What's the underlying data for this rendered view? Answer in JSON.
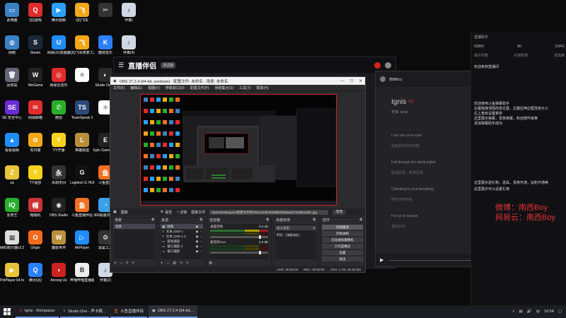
{
  "desktop_icons": [
    {
      "label": "此电脑",
      "color": "#3b82c4",
      "g": "▭"
    },
    {
      "label": "QQ游戏",
      "color": "#e02c2c",
      "g": "Q"
    },
    {
      "label": "腾讯视频",
      "color": "#2aa0ff",
      "g": "▶"
    },
    {
      "label": "QQ飞车",
      "color": "#f2a818",
      "g": "飞"
    },
    {
      "label": "",
      "color": "#333",
      "g": "✂"
    },
    {
      "label": "伴奏(",
      "color": "#cfd8e3",
      "g": "♪"
    },
    {
      "label": "网络",
      "color": "#3b82c4",
      "g": "◍"
    },
    {
      "label": "Steam",
      "color": "#1b2838",
      "g": "S"
    },
    {
      "label": "网易UU加速器",
      "color": "#1f8cff",
      "g": "U"
    },
    {
      "label": "QQ飞车修复工具",
      "color": "#f2a818",
      "g": "飞"
    },
    {
      "label": "酷狗音乐",
      "color": "#2a7fff",
      "g": "K"
    },
    {
      "label": "伴奏(4)",
      "color": "#cfd8e3",
      "g": "♪"
    },
    {
      "label": "回收站",
      "color": "#667",
      "g": "🗑"
    },
    {
      "label": "WeGame",
      "color": "#222",
      "g": "W"
    },
    {
      "label": "网易云音乐",
      "color": "#e02c2c",
      "g": "◎"
    },
    {
      "label": "",
      "color": "#fff",
      "g": "⚛"
    },
    {
      "label": "Studio One 4",
      "color": "#2a2a2a",
      "g": "◐"
    },
    {
      "label": "伴奏(1)",
      "color": "#cfd8e3",
      "g": "♪"
    },
    {
      "label": "SE 安全中心",
      "color": "#6b2bd6",
      "g": "SE"
    },
    {
      "label": "网易邮箱",
      "color": "#e02c2c",
      "g": "✉"
    },
    {
      "label": "微信",
      "color": "#2aae2a",
      "g": "✆"
    },
    {
      "label": "TeamSpeak 3",
      "color": "#2c4a7a",
      "g": "TS"
    },
    {
      "label": "",
      "color": "#fff",
      "g": "⚛"
    },
    {
      "label": "Apex Legends",
      "color": "#a11",
      "g": "A"
    },
    {
      "label": "看看视频",
      "color": "#1f8cff",
      "g": "▲"
    },
    {
      "label": "向日葵",
      "color": "#f2a818",
      "g": "✿"
    },
    {
      "label": "YY开播",
      "color": "#f7d21c",
      "g": "Y"
    },
    {
      "label": "英雄联盟",
      "color": "#b8903c",
      "g": "L"
    },
    {
      "label": "Epic Games Launcher",
      "color": "#222",
      "g": "E"
    },
    {
      "label": "",
      "color": "#444",
      "g": "▣"
    },
    {
      "label": "za",
      "color": "#e8c43a",
      "g": "Z"
    },
    {
      "label": "YY语音",
      "color": "#f7d21c",
      "g": "Y"
    },
    {
      "label": "永劫无间",
      "color": "#333",
      "g": "永"
    },
    {
      "label": "Logitech G HUB",
      "color": "#111",
      "g": "G"
    },
    {
      "label": "斗鱼直播",
      "color": "#f37021",
      "g": "鱼"
    },
    {
      "label": "360安全卫士",
      "color": "#2aae2a",
      "g": "+"
    },
    {
      "label": "爱奇艺",
      "color": "#2aae2a",
      "g": "iQ"
    },
    {
      "label": "帽帽机",
      "color": "#c33",
      "g": "帽"
    },
    {
      "label": "OBS Studio",
      "color": "#222",
      "g": "◉"
    },
    {
      "label": "斗鱼直播伴侣",
      "color": "#f37021",
      "g": "鱼"
    },
    {
      "label": "360极速浏览器",
      "color": "#3aa0e8",
      "g": "◔"
    },
    {
      "label": "百度网盘",
      "color": "#2a7fff",
      "g": "☁"
    },
    {
      "label": "网红统计器v3.2.0",
      "color": "#ddd",
      "g": "▦"
    },
    {
      "label": "Origin",
      "color": "#f26b1d",
      "g": "O"
    },
    {
      "label": "魔兽世界",
      "color": "#b8903c",
      "g": "W"
    },
    {
      "label": "AirPlayer",
      "color": "#1f8cff",
      "g": "▷"
    },
    {
      "label": "黑鲨工具",
      "color": "#333",
      "g": "⚙"
    },
    {
      "label": "伴奏(3)",
      "color": "#cfd8e3",
      "g": "♪"
    },
    {
      "label": "PotPlayer 64 bit",
      "color": "#e8c43a",
      "g": "▶"
    },
    {
      "label": "腾讯QQ",
      "color": "#2a7fff",
      "g": "Q"
    },
    {
      "label": "Among Us",
      "color": "#c22",
      "g": "◖"
    },
    {
      "label": "哔哩哔哩直播姬",
      "color": "#eee",
      "g": "B"
    },
    {
      "label": "伴奏(2)",
      "color": "#cfd8e3",
      "g": "♪"
    }
  ],
  "zbbl": {
    "logo": "直播伴侣",
    "version": "测试版"
  },
  "music": {
    "header": "南西Boy",
    "title": "Ignis",
    "tag": "SQ",
    "artist": "专辑: Ignis",
    "lyrics": [
      "I can see your eyes",
      "我能看到你的双眼",
      "Fall through the starlit nights",
      "跌落星夜，跌落星夜",
      "Checking to your breathing",
      "倾听你的呼吸",
      "For up to sunrise",
      "直到日出"
    ]
  },
  "chat": {
    "title": "直播助手",
    "stats": [
      "52850",
      "86",
      "11441"
    ],
    "tabs": [
      "观众列表",
      "礼物列表",
      "贵宾席"
    ],
    "msgs": [
      "欢迎来到直播间",
      "欢迎使用斗鱼弹幕助手",
      "左键拖拽顶部改变位置，左键拉伸边框改变大小",
      "右上角有设置菜单",
      "这里展示弹幕，贵族弹幕，粉丝牌升级等",
      "添加弹幕助手成功",
      "这里展示送礼物，道具，贵族开通，钻粉开通等",
      "这里展示可以设置礼物"
    ],
    "weibo": "微博：南西Boy",
    "netease": "网易云：南西Boy"
  },
  "obs": {
    "title": "OBS 27.2.4 (64-bit, windows) - 配置文件: 未命名 - 场景: 未命名",
    "menu": [
      "文件(F)",
      "编辑(E)",
      "视图(V)",
      "停靠窗口(D)",
      "配置文件(P)",
      "场景集合(S)",
      "工具(T)",
      "帮助(H)"
    ],
    "source_label": "图像",
    "props_label": "属性",
    "filters_label": "滤镜",
    "image_file_label": "图像文件",
    "path": "trator/Desktop/ss/新建文件夹/06a1204fe4bd9fab0f6a6a6a733d9e4a8fc.jpg",
    "browse": "浏览",
    "docks": {
      "scenes": "场景",
      "sources": "来源",
      "mixer": "混音器",
      "transitions": "场景转场",
      "controls": "控件"
    },
    "scene_item": "场景",
    "sources_list": [
      "图像",
      "文本 (GDI+)",
      "文本 (GDI+) 2",
      "游戏捕获",
      "窗口捕获 3",
      "窗口捕获"
    ],
    "mixer_list": [
      {
        "name": "桌面音频",
        "val": "0.0 dB"
      },
      {
        "name": "麦克风/Aux",
        "val": "0.0 dB"
      }
    ],
    "transition": "淡入淡出",
    "duration_label": "时长",
    "duration": "300 ms",
    "controls": [
      "开始推流",
      "开始录制",
      "启动虚拟摄像机",
      "工作室模式",
      "设置",
      "退出"
    ],
    "status": [
      "LIVE: 00:00:00",
      "REC: 00:00:00",
      "CPU: 1.4%, 60.00 fps"
    ]
  },
  "taskbar": {
    "items": [
      "Ignis - Rompasso",
      "Studio One - 声卡跳...",
      "斗鱼直播伴侣",
      "OBS 27.2.4 (64-bit,..."
    ],
    "time": "16:54",
    "lang": "中"
  }
}
